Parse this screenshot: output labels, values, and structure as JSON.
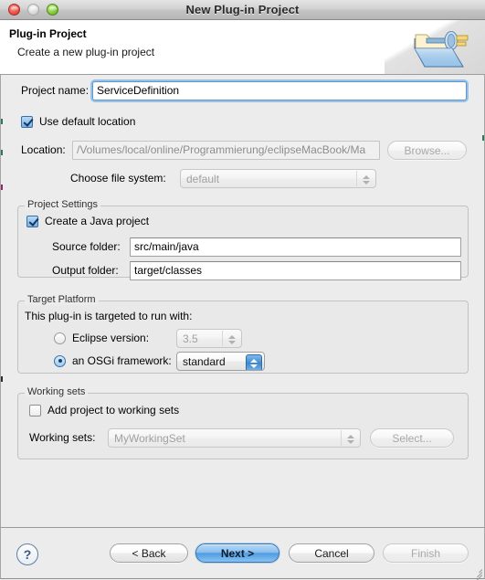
{
  "window": {
    "title": "New Plug-in Project",
    "traffic_lights": [
      {
        "name": "close",
        "color": "#f0554a"
      },
      {
        "name": "minimize",
        "color": "#dcdcdc"
      },
      {
        "name": "zoom",
        "color": "#86cb3c"
      }
    ]
  },
  "header": {
    "title": "Plug-in Project",
    "subtitle": "Create a new plug-in project",
    "icon": "plugin-project-folder-icon"
  },
  "form": {
    "project_name": {
      "label": "Project name:",
      "value": "ServiceDefinition",
      "focused": true
    },
    "use_default_location": {
      "label": "Use default location",
      "checked": true
    },
    "location": {
      "label": "Location:",
      "value": "/Volumes/local/online/Programmierung/eclipseMacBook/Ma",
      "disabled": true,
      "browse_label": "Browse..."
    },
    "file_system": {
      "label": "Choose file system:",
      "value": "default",
      "disabled": true
    }
  },
  "project_settings": {
    "group_title": "Project Settings",
    "create_java_project": {
      "label": "Create a Java project",
      "checked": true
    },
    "source_folder": {
      "label": "Source folder:",
      "value": "src/main/java"
    },
    "output_folder": {
      "label": "Output folder:",
      "value": "target/classes"
    }
  },
  "target_platform": {
    "group_title": "Target Platform",
    "intro": "This plug-in is targeted to run with:",
    "eclipse_version": {
      "label": "Eclipse version:",
      "selected": false,
      "value": "3.5",
      "disabled": true
    },
    "osgi_framework": {
      "label": "an OSGi framework:",
      "selected": true,
      "value": "standard",
      "disabled": false
    }
  },
  "working_sets": {
    "group_title": "Working sets",
    "add_to_working_sets": {
      "label": "Add project to working sets",
      "checked": false
    },
    "working_sets_field": {
      "label": "Working sets:",
      "value": "MyWorkingSet",
      "disabled": true
    },
    "select_button": {
      "label": "Select...",
      "disabled": true
    }
  },
  "footer": {
    "help_label": "?",
    "buttons": [
      {
        "label": "< Back",
        "state": "normal"
      },
      {
        "label": "Next >",
        "state": "default"
      },
      {
        "label": "Cancel",
        "state": "normal"
      },
      {
        "label": "Finish",
        "state": "disabled"
      }
    ]
  }
}
